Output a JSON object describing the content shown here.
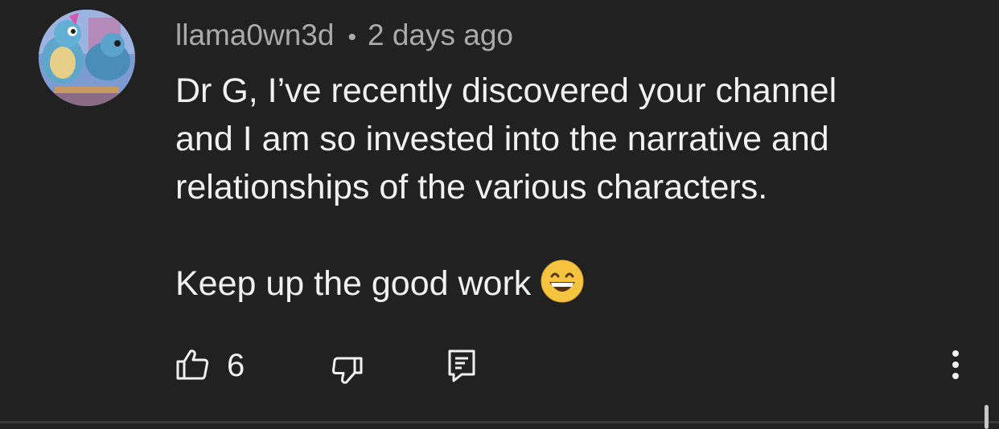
{
  "comment": {
    "author": "llama0wn3d",
    "separator": "•",
    "timestamp": "2 days ago",
    "body_lines": [
      "Dr G, I’ve recently discovered your channel",
      "and I am so invested into the narrative and",
      "relationships of the various characters."
    ],
    "closing_line": "Keep up the good work",
    "emoji": "grinning-face-with-smiling-eyes",
    "avatar": "squirtle-cartoon-avatar",
    "likes": "6"
  },
  "icons": {
    "like": "thumbs-up-icon",
    "dislike": "thumbs-down-icon",
    "reply": "reply-comment-icon",
    "more": "vertical-ellipsis-icon"
  },
  "colors": {
    "background": "#212121",
    "primary_text": "#f1f1f1",
    "secondary_text": "#aaaaaa",
    "icon": "#f1f1f1"
  }
}
